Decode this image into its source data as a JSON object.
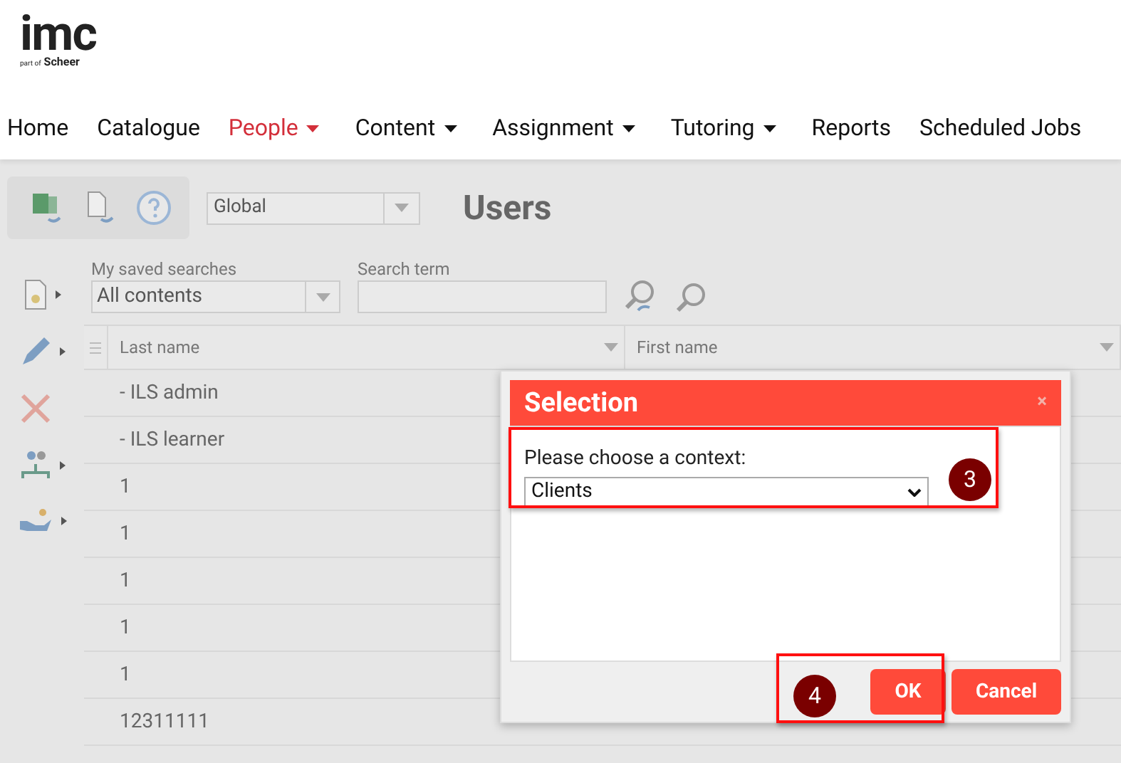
{
  "logo": {
    "name": "imc",
    "tagline_prefix": "part of",
    "tagline": "Scheer"
  },
  "nav": [
    {
      "label": "Home",
      "selected": false,
      "dropdown": false
    },
    {
      "label": "Catalogue",
      "selected": false,
      "dropdown": false
    },
    {
      "label": "People",
      "selected": true,
      "dropdown": true
    },
    {
      "label": "Content",
      "selected": false,
      "dropdown": true
    },
    {
      "label": "Assignment",
      "selected": false,
      "dropdown": true
    },
    {
      "label": "Tutoring",
      "selected": false,
      "dropdown": true
    },
    {
      "label": "Reports",
      "selected": false,
      "dropdown": false
    },
    {
      "label": "Scheduled Jobs",
      "selected": false,
      "dropdown": false
    }
  ],
  "context_select": {
    "value": "Global"
  },
  "page_title": "Users",
  "search": {
    "saved_label": "My saved searches",
    "saved_value": "All contents",
    "term_label": "Search term"
  },
  "table": {
    "columns": [
      "Last name",
      "First name"
    ],
    "rows": [
      {
        "last_name": "- ILS admin",
        "first_name": ""
      },
      {
        "last_name": "- ILS learner",
        "first_name": ""
      },
      {
        "last_name": "1",
        "first_name": ""
      },
      {
        "last_name": "1",
        "first_name": ""
      },
      {
        "last_name": "1",
        "first_name": ""
      },
      {
        "last_name": "1",
        "first_name": ""
      },
      {
        "last_name": "1",
        "first_name": ""
      },
      {
        "last_name": "12311111",
        "first_name": ""
      }
    ]
  },
  "dialog": {
    "title": "Selection",
    "close": "×",
    "prompt": "Please choose a context:",
    "value": "Clients",
    "buttons": [
      "OK",
      "Cancel"
    ]
  },
  "annotations": [
    "3",
    "4"
  ]
}
